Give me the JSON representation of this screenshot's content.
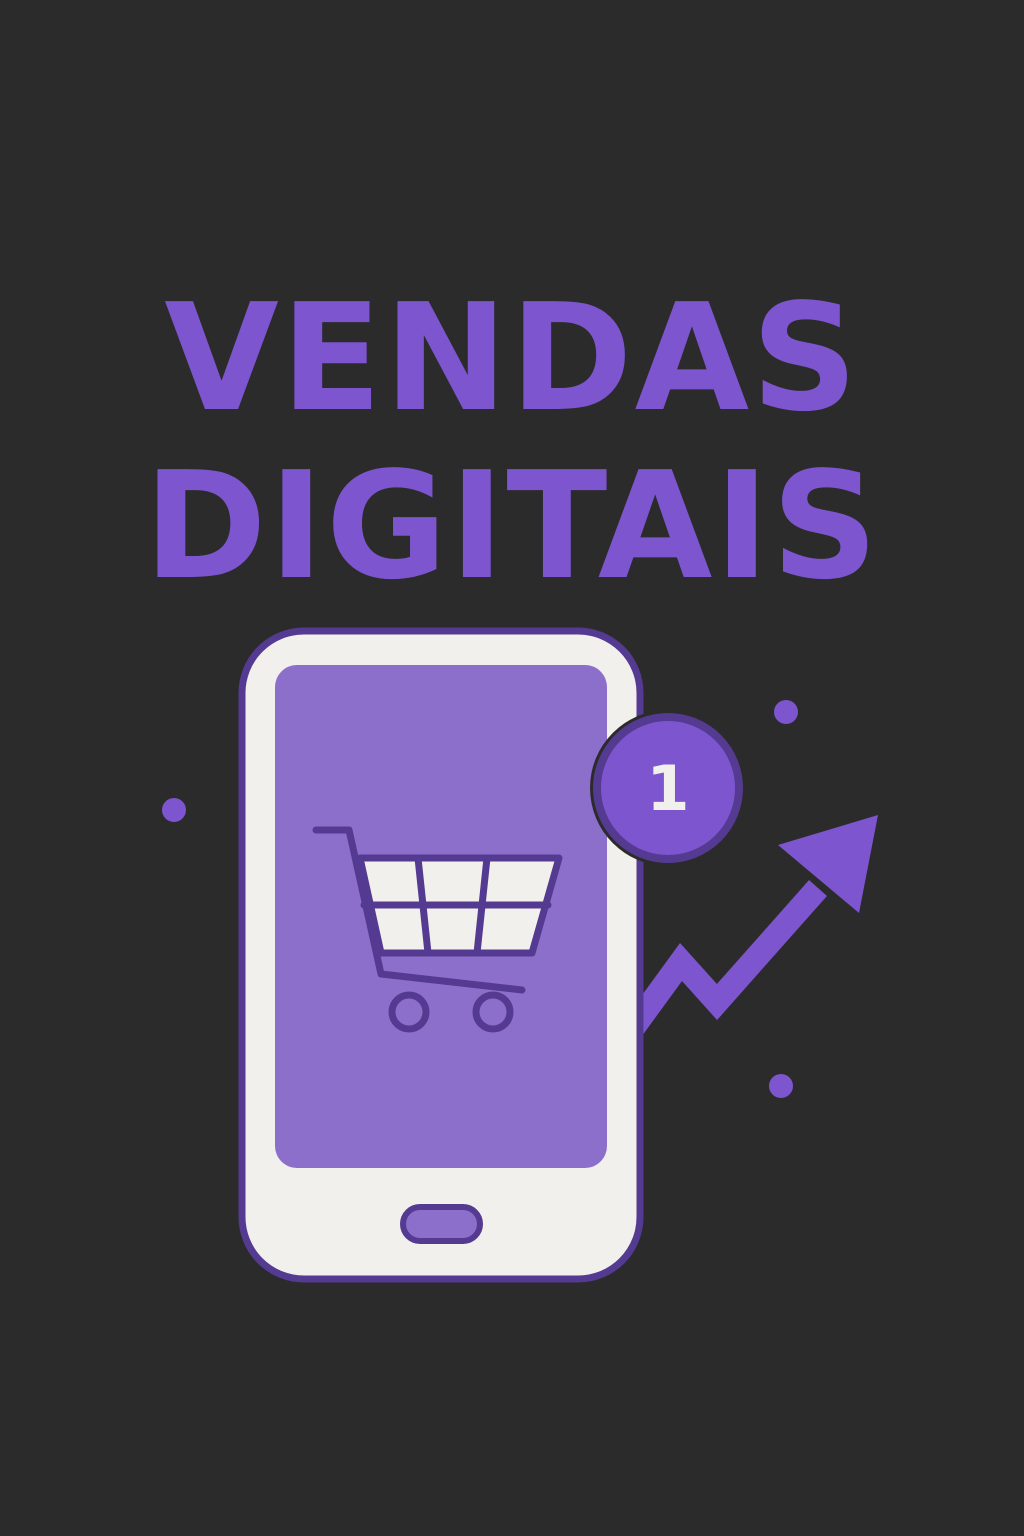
{
  "title": {
    "line1": "VENDAS",
    "line2": "DIGITAIS"
  },
  "notification_badge": {
    "count": "1"
  },
  "icons": {
    "phone": "smartphone-icon",
    "cart": "shopping-cart-icon",
    "trend": "trending-up-arrow-icon",
    "badge": "notification-badge-icon"
  },
  "colors": {
    "background": "#2b2b2b",
    "accent": "#7d55cf",
    "outline": "#553a91",
    "screen": "#8c6fcb",
    "phone_body": "#f2f0ec"
  }
}
